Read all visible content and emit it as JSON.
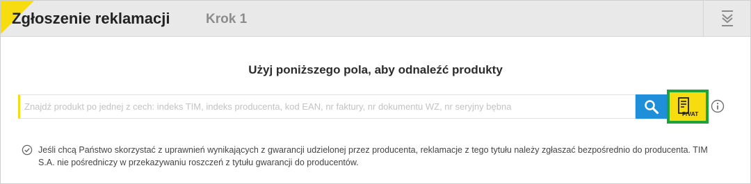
{
  "header": {
    "title": "Zgłoszenie reklamacji",
    "step": "Krok 1",
    "collapse_icon": "collapse-down-icon"
  },
  "search": {
    "instruction": "Użyj poniższego pola, aby odnaleźć produkty",
    "placeholder": "Znajdź produkt po jednej z cech: indeks TIM, indeks producenta, kod EAN, nr faktury, nr dokumentu WZ, nr seryjny bębna",
    "value": "",
    "search_icon": "search-icon",
    "invoice_button_label": "F/VAT",
    "info_icon": "info-icon"
  },
  "notice": {
    "icon": "check-circle-icon",
    "text": "Jeśli chcą Państwo skorzystać z uprawnień wynikających z gwarancji udzielonej przez producenta, reklamacje z tego tytułu należy zgłaszać bezpośrednio do producenta. TIM S.A. nie pośredniczy w przekazywaniu roszczeń z tytułu gwarancji do producentów."
  },
  "colors": {
    "accent_yellow": "#f7dd0f",
    "search_blue": "#1e8fd8",
    "highlight_green": "#1fa339",
    "header_bg": "#e9e9e9"
  }
}
